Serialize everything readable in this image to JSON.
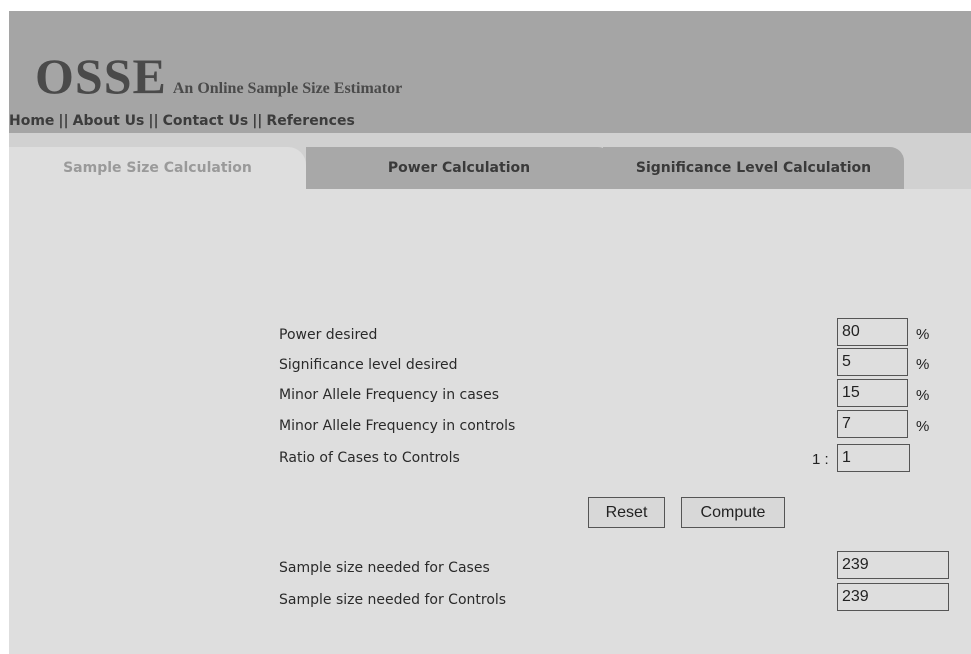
{
  "header": {
    "logo_main": "OSSE",
    "logo_sub": "An Online Sample Size Estimator",
    "nav": [
      "Home",
      "About Us",
      "Contact Us",
      "References"
    ],
    "nav_separator": "||"
  },
  "tabs": [
    {
      "label": "Sample Size Calculation",
      "active": true
    },
    {
      "label": "Power Calculation",
      "active": false
    },
    {
      "label": "Significance Level Calculation",
      "active": false
    }
  ],
  "form": {
    "power": {
      "label": "Power desired",
      "value": "80",
      "unit": "%"
    },
    "significance": {
      "label": "Significance level desired",
      "value": "5",
      "unit": "%"
    },
    "maf_cases": {
      "label": "Minor Allele Frequency in cases",
      "value": "15",
      "unit": "%"
    },
    "maf_controls": {
      "label": "Minor Allele Frequency in controls",
      "value": "7",
      "unit": "%"
    },
    "ratio": {
      "label": "Ratio of Cases to Controls",
      "prefix": "1 :",
      "value": "1"
    }
  },
  "buttons": {
    "reset": "Reset",
    "compute": "Compute"
  },
  "results": {
    "cases": {
      "label": "Sample size needed for Cases",
      "value": "239"
    },
    "controls": {
      "label": "Sample size needed for Controls",
      "value": "239"
    }
  }
}
